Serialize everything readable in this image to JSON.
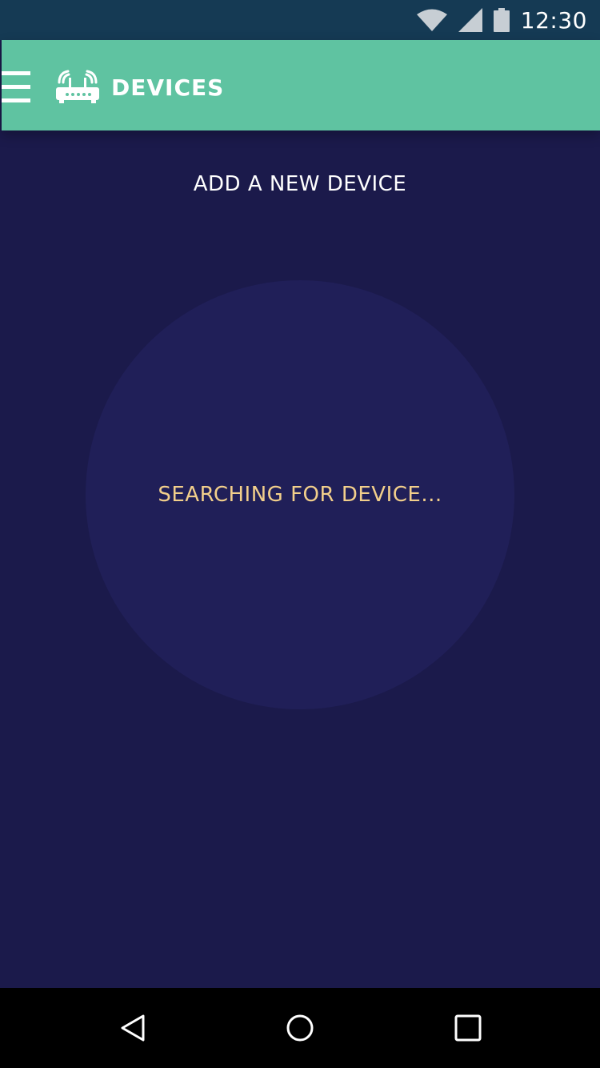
{
  "status_bar": {
    "time": "12:30",
    "icons": [
      "wifi-icon",
      "cell-signal-icon",
      "battery-icon"
    ]
  },
  "app_bar": {
    "title": "DEVICES",
    "menu_icon": "hamburger-menu-icon",
    "title_icon": "router-icon",
    "background_color": "#5fc3a1"
  },
  "main": {
    "heading": "ADD A NEW DEVICE",
    "search_status": "SEARCHING FOR DEVICE...",
    "background_color": "#1b1a4b",
    "circle_color": "#201f58",
    "status_color": "#f2cf8b"
  },
  "nav_bar": {
    "buttons": [
      "back-icon",
      "home-icon",
      "recent-apps-icon"
    ]
  }
}
